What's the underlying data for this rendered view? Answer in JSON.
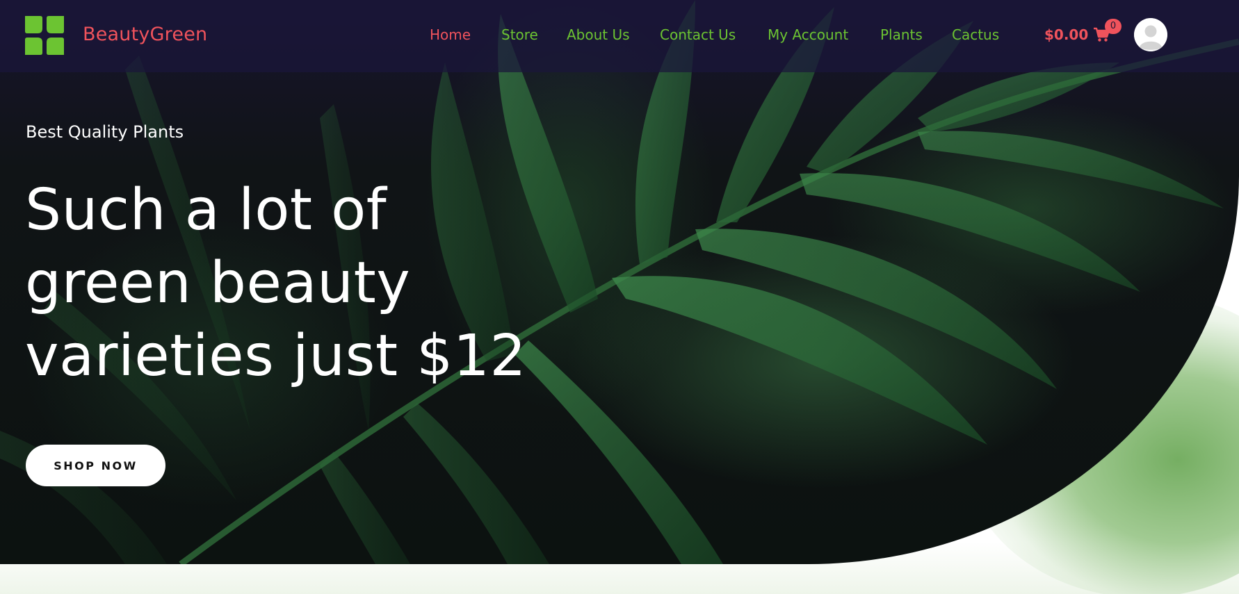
{
  "brand": {
    "name": "BeautyGreen"
  },
  "nav": {
    "items": [
      {
        "label": "Home",
        "active": true
      },
      {
        "label": "Store",
        "active": false
      },
      {
        "label": "About Us",
        "active": false
      },
      {
        "label": "Contact Us",
        "active": false
      },
      {
        "label": "My Account",
        "active": false
      },
      {
        "label": "Plants",
        "active": false
      },
      {
        "label": "Cactus",
        "active": false
      }
    ]
  },
  "cart": {
    "total": "$0.00",
    "count": "0",
    "icon": "shopping-cart-icon"
  },
  "account": {
    "icon": "user-avatar-icon"
  },
  "hero": {
    "eyebrow": "Best Quality Plants",
    "headline_lines": [
      "Such a lot of",
      "green beauty",
      "varieties just $12"
    ],
    "cta_label": "SHOP NOW"
  },
  "colors": {
    "accent": "#f0535c",
    "nav_link": "#6cc432",
    "logo_green": "#6cc432",
    "header_bg": "#1a163a"
  }
}
